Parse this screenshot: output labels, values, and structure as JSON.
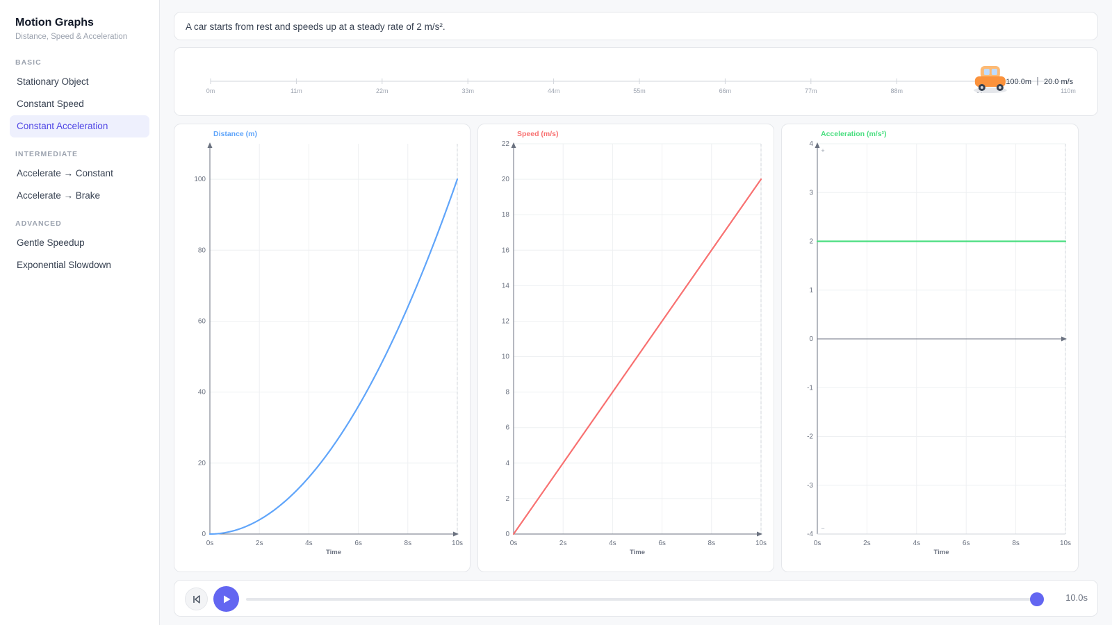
{
  "app": {
    "title": "Motion Graphs",
    "subtitle": "Distance, Speed & Acceleration"
  },
  "sidebar": {
    "sections": [
      {
        "label": "BASIC",
        "items": [
          {
            "label": "Stationary Object",
            "active": false
          },
          {
            "label": "Constant Speed",
            "active": false
          },
          {
            "label": "Constant Acceleration",
            "active": true
          }
        ]
      },
      {
        "label": "INTERMEDIATE",
        "items": [
          {
            "label": "Accelerate → Constant",
            "active": false
          },
          {
            "label": "Accelerate → Brake",
            "active": false
          }
        ]
      },
      {
        "label": "ADVANCED",
        "items": [
          {
            "label": "Gentle Speedup",
            "active": false
          },
          {
            "label": "Exponential Slowdown",
            "active": false
          }
        ]
      }
    ]
  },
  "description": "A car starts from rest and speeds up at a steady rate of 2 m/s².",
  "track": {
    "ticks": [
      "0m",
      "11m",
      "22m",
      "33m",
      "44m",
      "55m",
      "66m",
      "77m",
      "88m",
      "99m",
      "110m"
    ],
    "max_distance": 110,
    "car_position": 100,
    "distance_readout": "100.0m",
    "speed_readout": "20.0 m/s",
    "car_icon": "car-icon"
  },
  "colors": {
    "distance": "#60a5fa",
    "speed": "#f87171",
    "acceleration": "#4ade80",
    "accent": "#6366f1"
  },
  "player": {
    "time_readout": "10.0s",
    "progress": 1.0,
    "reset_icon": "skip-back-icon",
    "play_icon": "play-icon"
  },
  "chart_data": [
    {
      "type": "line",
      "title": "Distance (m)",
      "xlabel": "Time",
      "x_tick_labels": [
        "0s",
        "2s",
        "4s",
        "6s",
        "8s",
        "10s"
      ],
      "xlim": [
        0,
        10
      ],
      "y_ticks": [
        0,
        20,
        40,
        60,
        80,
        100
      ],
      "ylim": [
        0,
        110
      ],
      "x": [
        0,
        1,
        2,
        3,
        4,
        5,
        6,
        7,
        8,
        9,
        10
      ],
      "y": [
        0,
        1,
        4,
        9,
        16,
        25,
        36,
        49,
        64,
        81,
        100
      ],
      "color": "#60a5fa",
      "grid": true
    },
    {
      "type": "line",
      "title": "Speed (m/s)",
      "xlabel": "Time",
      "x_tick_labels": [
        "0s",
        "2s",
        "4s",
        "6s",
        "8s",
        "10s"
      ],
      "xlim": [
        0,
        10
      ],
      "y_ticks": [
        0,
        2,
        4,
        6,
        8,
        10,
        12,
        14,
        16,
        18,
        20,
        22
      ],
      "ylim": [
        0,
        22
      ],
      "x": [
        0,
        10
      ],
      "y": [
        0,
        20
      ],
      "color": "#f87171",
      "grid": true
    },
    {
      "type": "line",
      "title": "Acceleration (m/s²)",
      "xlabel": "Time",
      "x_tick_labels": [
        "0s",
        "2s",
        "4s",
        "6s",
        "8s",
        "10s"
      ],
      "xlim": [
        0,
        10
      ],
      "y_ticks": [
        -4,
        -3,
        -2,
        -1,
        0,
        1,
        2,
        3,
        4
      ],
      "ylim": [
        -4,
        4
      ],
      "x": [
        0,
        10
      ],
      "y": [
        2,
        2
      ],
      "color": "#4ade80",
      "grid": true,
      "markers": [
        "+",
        "−"
      ]
    }
  ]
}
